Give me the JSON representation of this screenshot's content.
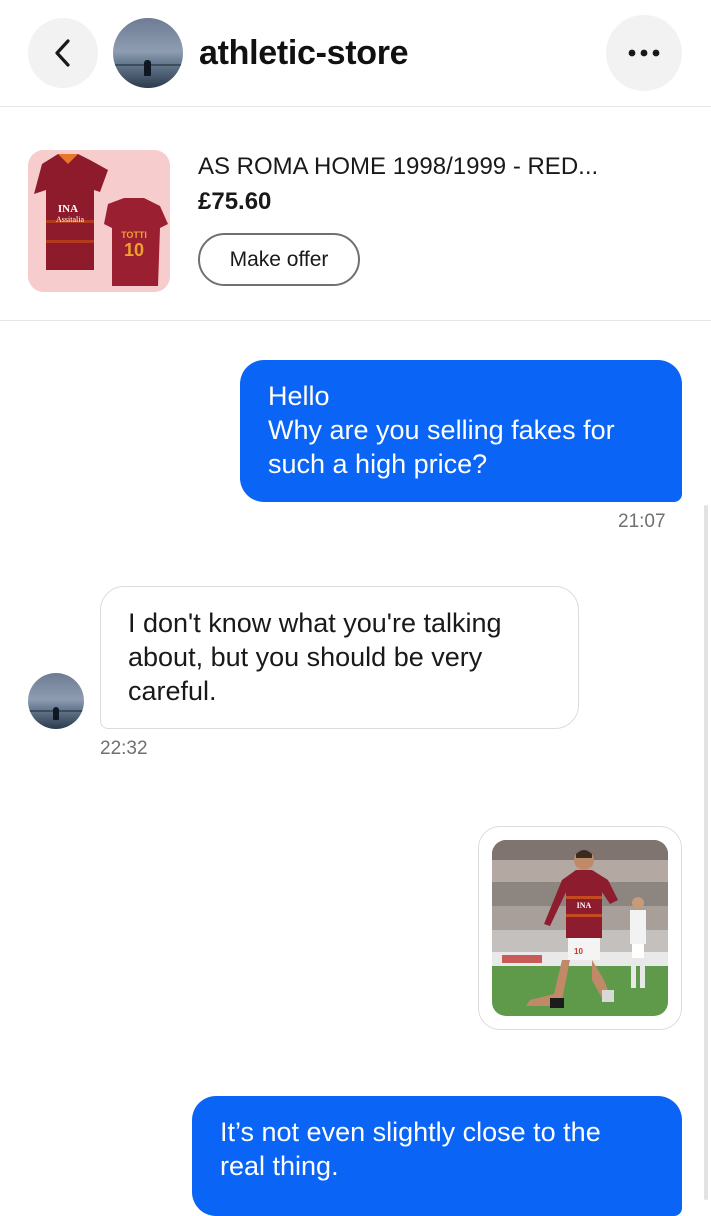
{
  "header": {
    "seller_name": "athletic-store",
    "back_icon": "chevron-left-icon",
    "more_icon": "ellipsis-icon"
  },
  "item": {
    "title": "AS ROMA HOME 1998/1999 - RED...",
    "price": "£75.60",
    "offer_label": "Make offer",
    "thumbnail_icon": "jersey-image"
  },
  "messages": [
    {
      "direction": "outgoing",
      "lines": [
        "Hello",
        "Why are you selling fakes for",
        "such a high price?"
      ],
      "time": "21:07"
    },
    {
      "direction": "incoming",
      "lines": [
        "I don't know what you're talking",
        "about, but you should be very",
        "careful."
      ],
      "time": "22:32"
    },
    {
      "direction": "outgoing",
      "type": "image",
      "image": "player-in-jersey-photo"
    },
    {
      "direction": "outgoing",
      "lines": [
        "It’s not even slightly close to the",
        "real thing."
      ]
    }
  ],
  "colors": {
    "accent": "#0a64f5",
    "bubble_border": "#dcdcdc",
    "jersey": "#8d1c2e",
    "pitch": "#5e9a4a"
  }
}
